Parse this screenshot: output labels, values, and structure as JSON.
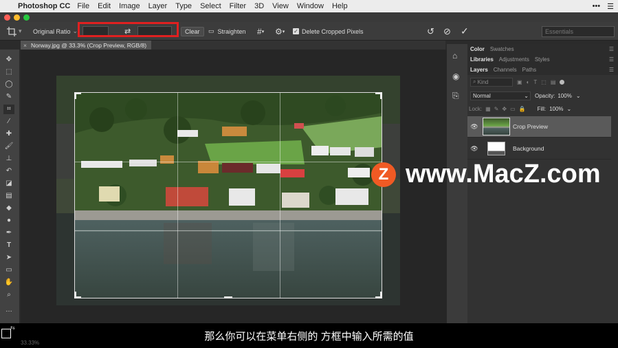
{
  "menubar": {
    "app_name": "Photoshop CC",
    "items": [
      "File",
      "Edit",
      "Image",
      "Layer",
      "Type",
      "Select",
      "Filter",
      "3D",
      "View",
      "Window",
      "Help"
    ]
  },
  "options_bar": {
    "ratio_preset": "Original Ratio",
    "clear_label": "Clear",
    "straighten_label": "Straighten",
    "delete_cropped_label": "Delete Cropped Pixels",
    "workspace": "Essentials"
  },
  "document": {
    "tab_title": "Norway.jpg @ 33.3% (Crop Preview, RGB/8)",
    "close_glyph": "×"
  },
  "panels": {
    "tabs_top": [
      "Color",
      "Swatches"
    ],
    "tabs_mid": [
      "Libraries",
      "Adjustments",
      "Styles"
    ],
    "tabs_layers": [
      "Layers",
      "Channels",
      "Paths"
    ],
    "kind_placeholder": "Kind",
    "blend_mode": "Normal",
    "opacity_label": "Opacity:",
    "opacity_value": "100%",
    "lock_label": "Lock:",
    "fill_label": "Fill:",
    "fill_value": "100%",
    "layers": [
      {
        "name": "Crop Preview"
      },
      {
        "name": "Background"
      }
    ]
  },
  "status": {
    "zoom": "33.33%"
  },
  "subtitle": "那么你可以在菜单右侧的 方框中输入所需的值",
  "watermark": {
    "logo_letter": "Z",
    "text": "www.MacZ.com"
  },
  "colors": {
    "highlight": "#e02020",
    "watermark_logo": "#f05a24"
  }
}
